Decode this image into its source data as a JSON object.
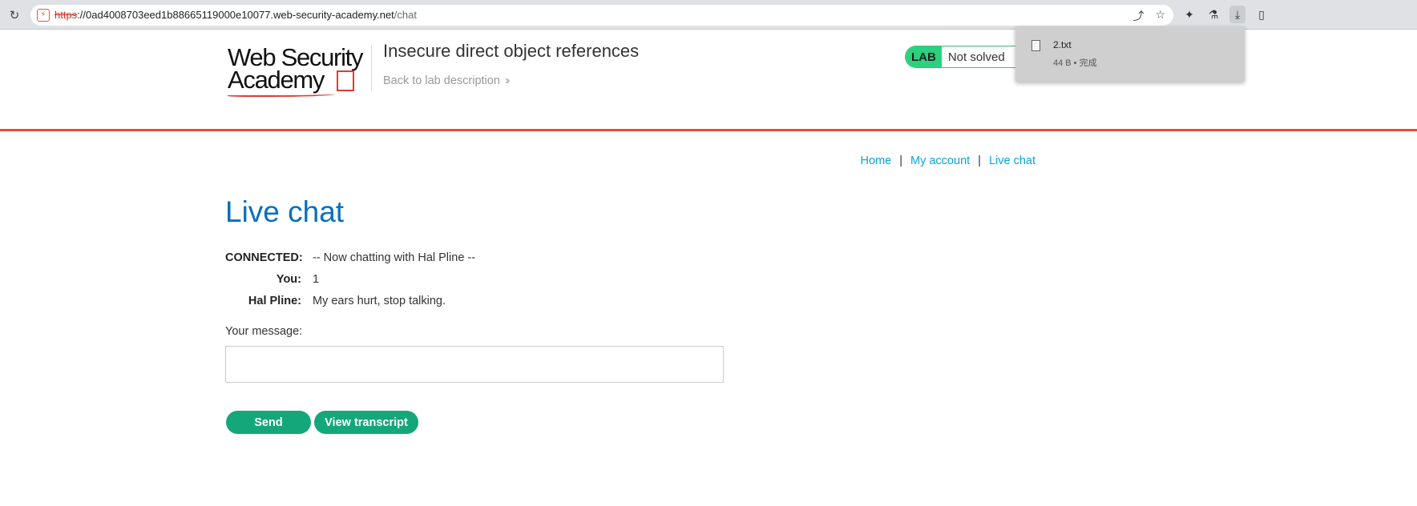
{
  "browser": {
    "url_scheme": "https",
    "url_host": "://0ad4008703eed1b88665119000e10077.web-security-academy.net",
    "url_path": "/chat"
  },
  "header": {
    "logo_line1": "Web Security",
    "logo_line2": "Academy",
    "lab_title": "Insecure direct object references",
    "back_link": "Back to lab description",
    "lab_badge": "LAB",
    "lab_status": "Not solved"
  },
  "download": {
    "file_name": "2.txt",
    "file_meta": "44 B • 完成"
  },
  "nav": {
    "home": "Home",
    "my_account": "My account",
    "live_chat": "Live chat"
  },
  "main": {
    "title": "Live chat",
    "messages": [
      {
        "who": "CONNECTED:",
        "text": "-- Now chatting with Hal Pline --"
      },
      {
        "who": "You:",
        "text": "1"
      },
      {
        "who": "Hal Pline:",
        "text": "My ears hurt, stop talking."
      }
    ],
    "message_label": "Your message:",
    "message_value": "",
    "send_label": "Send",
    "view_transcript_label": "View transcript"
  }
}
